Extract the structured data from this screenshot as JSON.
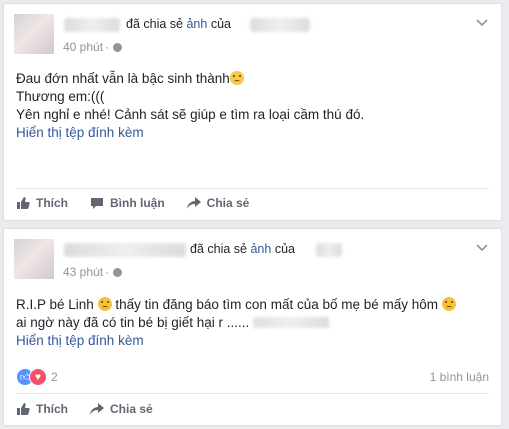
{
  "post1": {
    "header_suffix": "đã chia sẻ",
    "header_link": "ảnh",
    "header_of": "của",
    "time": "40 phút",
    "lines": [
      "Đau đớn nhất vẫn là bậc sinh thành",
      "Thương em:(((",
      "Yên nghỉ e nhé! Cảnh sát sẽ giúp e tìm ra loại cầm thú đó."
    ],
    "attachment_link": "Hiển thị tệp đính kèm",
    "actions": {
      "like": "Thích",
      "comment": "Bình luận",
      "share": "Chia sẻ"
    }
  },
  "post2": {
    "header_suffix": "đã chia sẻ",
    "header_link": "ảnh",
    "header_of": "của",
    "time": "43 phút",
    "line1": "R.I.P bé Linh",
    "line1b": "thấy tin đăng báo tìm con mất của bố mẹ bé mấy hôm",
    "line2": "ai ngờ này đã có tin bé bị giết hại r ......",
    "attachment_link": "Hiển thị tệp đính kèm",
    "reaction_count": "2",
    "comment_count": "1 bình luận",
    "actions": {
      "like": "Thích",
      "share": "Chia sẻ"
    }
  },
  "icons": [
    "avatar-placeholder",
    "globe-icon",
    "chevron-down-icon",
    "thumbs-up-icon",
    "comment-icon",
    "share-arrow-icon",
    "like-reaction-icon",
    "love-reaction-icon",
    "crying-emoji-icon",
    "sad-emoji-icon"
  ],
  "colors": {
    "link": "#365899",
    "meta": "#90949c",
    "like_reaction": "#5890ff",
    "love_reaction": "#f25268"
  }
}
